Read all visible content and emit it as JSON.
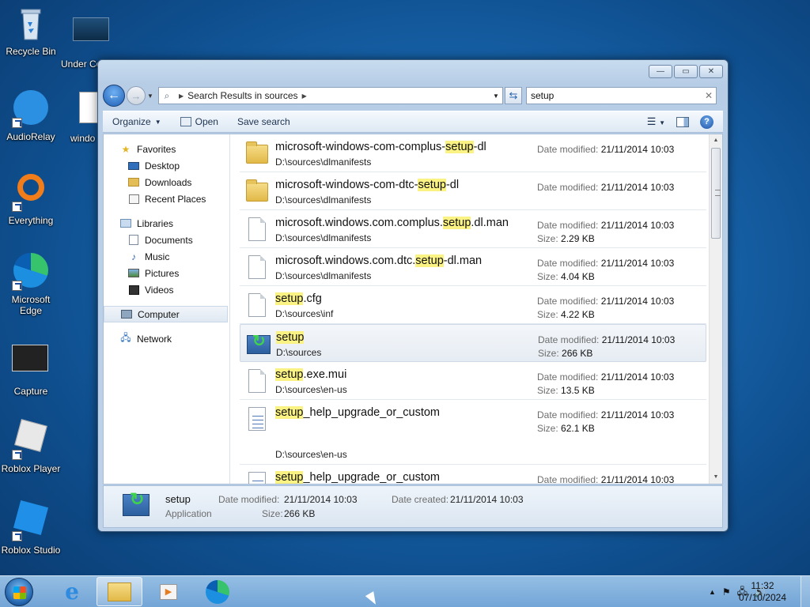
{
  "desktop": {
    "icons": [
      {
        "label": "Recycle Bin"
      },
      {
        "label": "Under Concurr"
      },
      {
        "label": "AudioRelay"
      },
      {
        "label": "windo"
      },
      {
        "label": "Everything"
      },
      {
        "label": "Microsoft Edge"
      },
      {
        "label": "Capture"
      },
      {
        "label": "Roblox Player"
      },
      {
        "label": "Roblox Studio"
      }
    ]
  },
  "window": {
    "controls": {
      "minimize": "—",
      "maximize": "▭",
      "close": "✕"
    },
    "address": {
      "breadcrumb": "Search Results in sources"
    },
    "search": {
      "value": "setup"
    },
    "toolbar": {
      "organize": "Organize",
      "open": "Open",
      "save_search": "Save search"
    },
    "nav": {
      "favorites": {
        "label": "Favorites",
        "items": [
          "Desktop",
          "Downloads",
          "Recent Places"
        ]
      },
      "libraries": {
        "label": "Libraries",
        "items": [
          "Documents",
          "Music",
          "Pictures",
          "Videos"
        ]
      },
      "computer": "Computer",
      "network": "Network"
    },
    "results": [
      {
        "pre": "microsoft-windows-com-complus-",
        "hl": "setup",
        "post": "-dl",
        "path": "D:\\sources\\dlmanifests",
        "modified_label": "Date modified:",
        "modified": "21/11/2014 10:03",
        "size_label": "",
        "size": "",
        "type": "folder"
      },
      {
        "pre": "microsoft-windows-com-dtc-",
        "hl": "setup",
        "post": "-dl",
        "path": "D:\\sources\\dlmanifests",
        "modified_label": "Date modified:",
        "modified": "21/11/2014 10:03",
        "size_label": "",
        "size": "",
        "type": "folder"
      },
      {
        "pre": "microsoft.windows.com.complus.",
        "hl": "setup",
        "post": ".dl.man",
        "path": "D:\\sources\\dlmanifests",
        "modified_label": "Date modified:",
        "modified": "21/11/2014 10:03",
        "size_label": "Size:",
        "size": "2.29 KB",
        "type": "file"
      },
      {
        "pre": "microsoft.windows.com.dtc.",
        "hl": "setup",
        "post": "-dl.man",
        "path": "D:\\sources\\dlmanifests",
        "modified_label": "Date modified:",
        "modified": "21/11/2014 10:03",
        "size_label": "Size:",
        "size": "4.04 KB",
        "type": "file"
      },
      {
        "pre": "",
        "hl": "setup",
        "post": ".cfg",
        "path": "D:\\sources\\inf",
        "modified_label": "Date modified:",
        "modified": "21/11/2014 10:03",
        "size_label": "Size:",
        "size": "4.22 KB",
        "type": "file"
      },
      {
        "pre": "",
        "hl": "setup",
        "post": "",
        "path": "D:\\sources",
        "modified_label": "Date modified:",
        "modified": "21/11/2014 10:03",
        "size_label": "Size:",
        "size": "266 KB",
        "type": "setup"
      },
      {
        "pre": "",
        "hl": "setup",
        "post": ".exe.mui",
        "path": "D:\\sources\\en-us",
        "modified_label": "Date modified:",
        "modified": "21/11/2014 10:03",
        "size_label": "Size:",
        "size": "13.5 KB",
        "type": "file"
      },
      {
        "pre": "",
        "hl": "setup",
        "post": "_help_upgrade_or_custom",
        "path": "D:\\sources\\en-us",
        "modified_label": "Date modified:",
        "modified": "21/11/2014 10:03",
        "size_label": "Size:",
        "size": "62.1 KB",
        "type": "doc"
      },
      {
        "pre": "",
        "hl": "setup",
        "post": "_help_upgrade_or_custom",
        "path": "",
        "modified_label": "Date modified:",
        "modified": "21/11/2014 10:03",
        "size_label": "",
        "size": "",
        "type": "doc"
      }
    ],
    "details": {
      "name": "setup",
      "type": "Application",
      "modified_label": "Date modified:",
      "modified": "21/11/2014 10:03",
      "created_label": "Date created:",
      "created": "21/11/2014 10:03",
      "size_label": "Size:",
      "size": "266 KB"
    }
  },
  "taskbar": {
    "time": "11:32",
    "date": "07/10/2024",
    "tray_up": "▲"
  }
}
